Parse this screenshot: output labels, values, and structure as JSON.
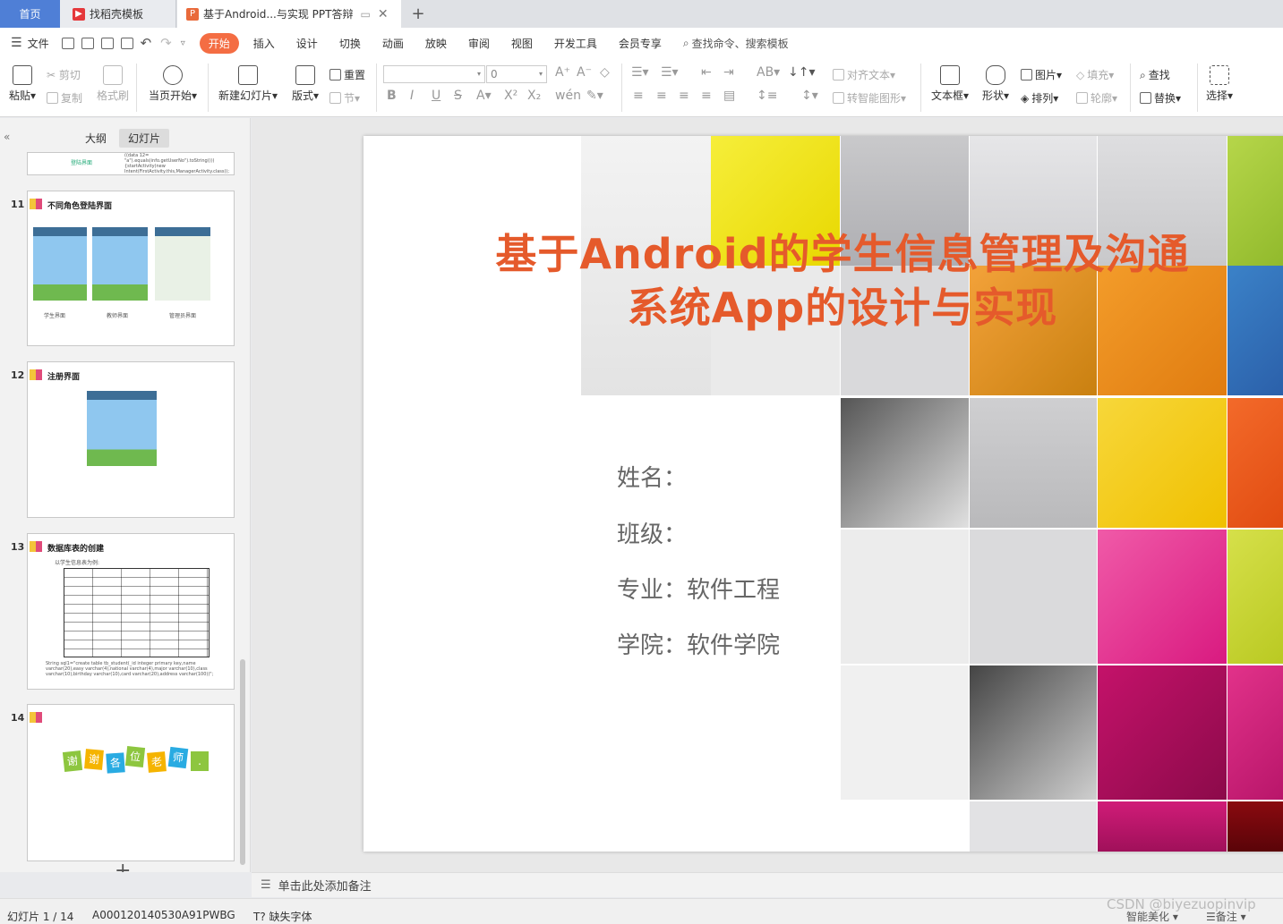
{
  "tabs": [
    {
      "label": "首页"
    },
    {
      "label": "找稻壳模板"
    },
    {
      "label": "基于Android...与实现 PPT答辩"
    }
  ],
  "menu": {
    "file": "文件",
    "items": [
      "开始",
      "插入",
      "设计",
      "切换",
      "动画",
      "放映",
      "审阅",
      "视图",
      "开发工具",
      "会员专享"
    ],
    "search": "查找命令、搜索模板"
  },
  "ribbon": {
    "paste": "粘贴",
    "cut": "剪切",
    "copy": "复制",
    "format_painter": "格式刷",
    "from_current": "当页开始",
    "new_slide": "新建幻灯片",
    "layout": "版式",
    "reset": "重置",
    "section": "节",
    "font_size_value": "0",
    "align_text": "对齐文本",
    "smart_art": "转智能图形",
    "text_box": "文本框",
    "shape": "形状",
    "picture": "图片",
    "arrange": "排列",
    "fill": "填充",
    "outline": "轮廓",
    "find": "查找",
    "replace": "替换",
    "select": "选择"
  },
  "left_panel": {
    "outline_tab": "大纲",
    "slides_tab": "幻灯片",
    "prev_slide_caption": "登陆界面",
    "prev_slide_code": "((data 12= \"a\").equals(info.getUserNo\").toString())){startActivity(new Intent(FirstActivity.this,ManagerActivity.class));",
    "slides": [
      {
        "num": "11",
        "title": "不同角色登陆界面",
        "captions": [
          "学生界面",
          "教师界面",
          "管理员界面"
        ]
      },
      {
        "num": "12",
        "title": "注册界面"
      },
      {
        "num": "13",
        "title": "数据库表的创建",
        "subtitle": "以学生信息表为例:",
        "code": "String sql1=\"create table tb_student(_id integer primary key,name varchar(20),easy varchar(4),national varchar(4),major varchar(10),class varchar(10),birthday varchar(10),card varchar(20),address varchar(100))\";"
      },
      {
        "num": "14",
        "thanks": [
          "谢",
          "谢",
          "各",
          "位",
          "老",
          "师",
          "."
        ]
      }
    ],
    "add_slide": "+"
  },
  "slide": {
    "title_line1": "基于Android的学生信息管理及沟通",
    "title_line2": "系统App的设计与实现",
    "info": [
      "姓名：",
      "班级：",
      "专业：软件工程",
      "学院：软件学院"
    ]
  },
  "notes": {
    "placeholder": "单击此处添加备注"
  },
  "status": {
    "slide_count": "幻灯片 1 / 14",
    "theme": "A000120140530A91PWBG",
    "missing_font": "缺失字体",
    "smart_beautify": "智能美化",
    "notes_btn": "备注"
  },
  "watermark": "CSDN @biyezuopinvip",
  "colors": {
    "accent": "#f46d43",
    "title": "#e55a2b",
    "home_tab": "#4f7fd6"
  }
}
